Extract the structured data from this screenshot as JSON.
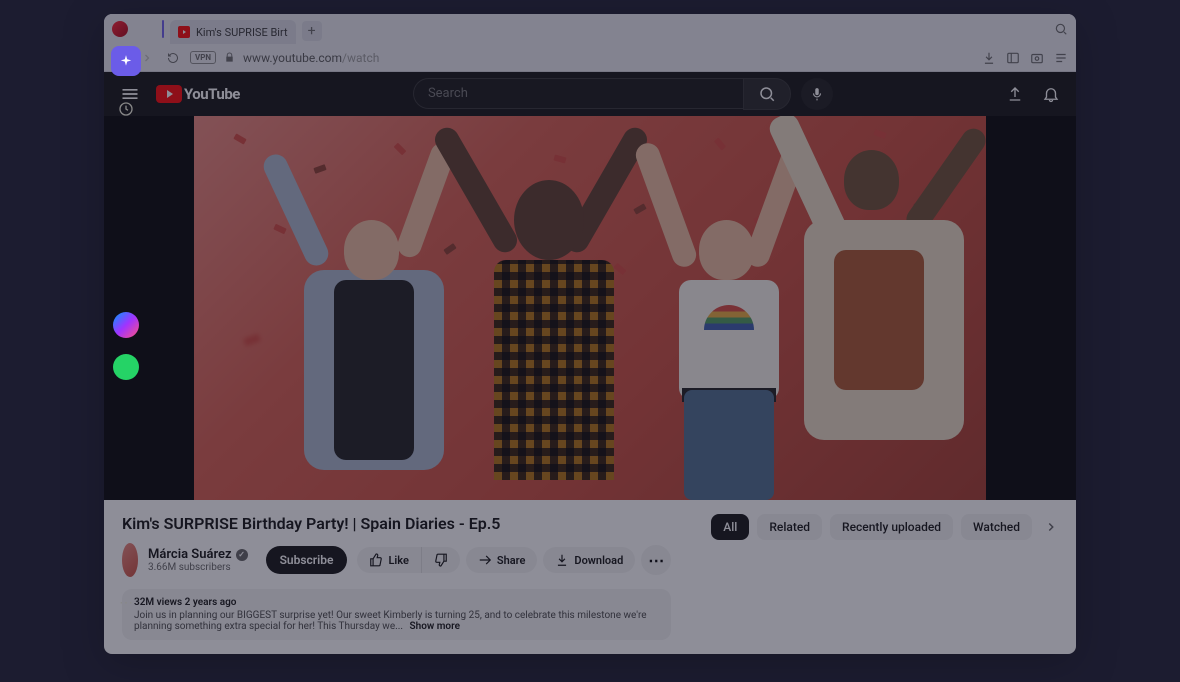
{
  "browser": {
    "tab_title": "Kim's SUPRISE Birt",
    "url_domain": "www.youtube.com",
    "url_path": "/watch",
    "vpn_label": "VPN"
  },
  "youtube": {
    "logo_text": "YouTube",
    "search_placeholder": "Search"
  },
  "video": {
    "title": "Kim's SURPRISE Birthday Party! | Spain Diaries - Ep.5",
    "channel_name": "Márcia Suárez",
    "subscribers": "3.66M subscribers",
    "subscribe_label": "Subscribe",
    "like_label": "Like",
    "share_label": "Share",
    "download_label": "Download",
    "views_age": "32M views  2 years ago",
    "description_snippet": "Join us in planning our BIGGEST surprise yet! Our sweet Kimberly is turning 25, and to celebrate this milestone we're planning something extra special for her! This Thursday we...",
    "show_more": "Show more"
  },
  "chips": {
    "all": "All",
    "related": "Related",
    "recent": "Recently uploaded",
    "watched": "Watched"
  }
}
